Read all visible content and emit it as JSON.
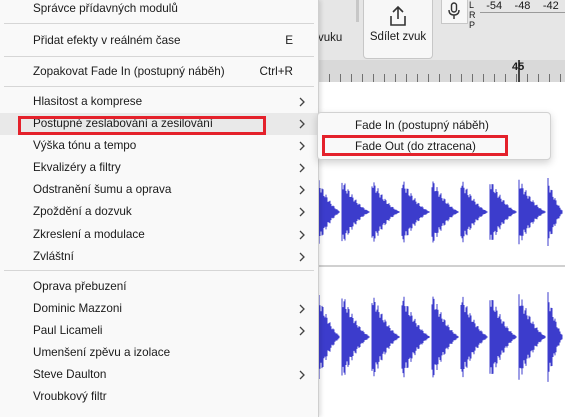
{
  "toolbar": {
    "share_label": "Sdílet zvuk",
    "fragment_label": "vuku",
    "meter_letters": [
      "L",
      "R",
      "P"
    ],
    "meter_scale": [
      "-54",
      "-48",
      "-42"
    ]
  },
  "ruler": {
    "label": "45"
  },
  "menu": {
    "items": [
      {
        "label": "Správce přídavných modulů"
      },
      {
        "label": "Přidat efekty v reálném čase",
        "shortcut": "E"
      },
      {
        "label": "Zopakovat Fade In (postupný náběh)",
        "shortcut": "Ctrl+R"
      },
      {
        "label": "Hlasitost a komprese"
      },
      {
        "label": "Postupné zeslabování a zesilování"
      },
      {
        "label": "Výška tónu a tempo"
      },
      {
        "label": "Ekvalizéry a filtry"
      },
      {
        "label": "Odstranění šumu a oprava"
      },
      {
        "label": "Zpoždění a dozvuk"
      },
      {
        "label": "Zkreslení a modulace"
      },
      {
        "label": "Zvláštní"
      },
      {
        "label": "Oprava přebuzení"
      },
      {
        "label": "Dominic Mazzoni"
      },
      {
        "label": "Paul Licameli"
      },
      {
        "label": "Umenšení zpěvu a izolace"
      },
      {
        "label": "Steve Daulton"
      },
      {
        "label": "Vroubkový filtr"
      }
    ]
  },
  "submenu": {
    "items": [
      {
        "label": "Fade In (postupný náběh)"
      },
      {
        "label": "Fade Out (do ztracena)"
      }
    ]
  },
  "colors": {
    "highlight": "#e4212b",
    "waveform": "#3c3ccc"
  },
  "icons": {
    "share": "share-icon",
    "mic": "microphone-icon",
    "submenu": "chevron-right-icon"
  }
}
